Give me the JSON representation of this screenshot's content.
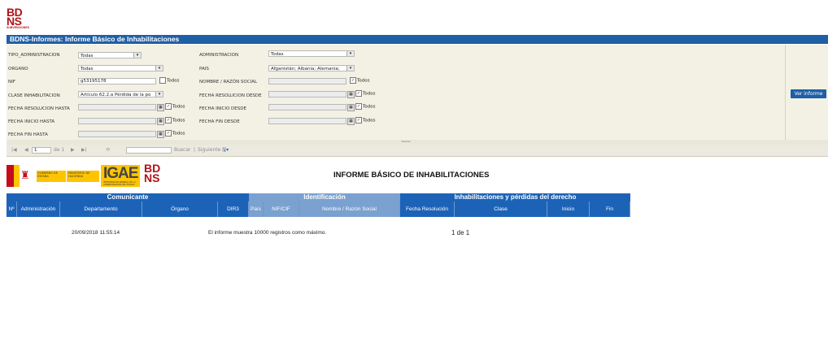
{
  "logo": {
    "line1": "BD",
    "line2": "NS",
    "sub": "SUBVENCIONES"
  },
  "title": "BDNS-Informes:  Informe Básico de Inhabilitaciones",
  "params": {
    "tipo_admin": {
      "label": "TIPO_ADMINISTRACION",
      "value": "Todas"
    },
    "administracion": {
      "label": "ADMINISTRACION",
      "value": "Todas"
    },
    "organo": {
      "label": "ORGANO",
      "value": "Todas"
    },
    "pais": {
      "label": "PAIS",
      "value": "Afganistán; Albania; Alemania;"
    },
    "nif": {
      "label": "NIF",
      "value": "g53195178",
      "chk": "Todos"
    },
    "nombre": {
      "label": "NOMBRE / RAZÓN SOCIAL",
      "chk": "Todos"
    },
    "clase": {
      "label": "CLASE INHABILITACION",
      "value": "Artículo 62.2.a Pérdida de la po"
    },
    "f_res_desde": {
      "label": "FECHA RESOLUCION DESDE",
      "chk": "Todos"
    },
    "f_res_hasta": {
      "label": "FECHA RESOLUCION HASTA",
      "chk": "Todos"
    },
    "f_ini_desde": {
      "label": "FECHA INICIO DESDE",
      "chk": "Todos"
    },
    "f_ini_hasta": {
      "label": "FECHA INICIO HASTA",
      "chk": "Todos"
    },
    "f_fin_desde": {
      "label": "FECHA FIN DESDE",
      "chk": "Todos"
    },
    "f_fin_hasta": {
      "label": "FECHA FIN HASTA",
      "chk": "Todos"
    },
    "ver_informe": "Ver informe"
  },
  "toolbar": {
    "page": "1",
    "of": "de 1",
    "find": "Buscar",
    "sep": "|",
    "next": "Siguiente"
  },
  "report": {
    "logo_gobierno": "GOBIERNO DE ESPAÑA",
    "logo_ministerio": "MINISTERIO DE HACIENDA",
    "logo_igae": "IGAE",
    "logo_igae_sub": "INTERVENCIÓN GENERAL DE LA ADMINISTRACIÓN DEL ESTADO",
    "logo_bd1": "BD",
    "logo_bd2": "NS",
    "title": "INFORME BÁSICO DE INHABILITACIONES",
    "groups": [
      "Comunicante",
      "Identificación",
      "Inhabilitaciones y pérdidas del derecho"
    ],
    "columns": [
      "Nº",
      "Administración",
      "Departamento",
      "Órgano",
      "DIR3",
      "País",
      "NIF/CIF",
      "Nombre / Razón Social",
      "Fecha Resolución",
      "Clase",
      "Inicio",
      "Fin"
    ],
    "date": "20/09/2018 11:55:14",
    "note": "El informe muestra 10000 registros como máximo.",
    "pages": "1 de 1"
  },
  "colors": {
    "blue": "#1f5fa6",
    "header": "#1c63b8",
    "header_ident": "#7aa1cf",
    "red": "#b11217"
  }
}
